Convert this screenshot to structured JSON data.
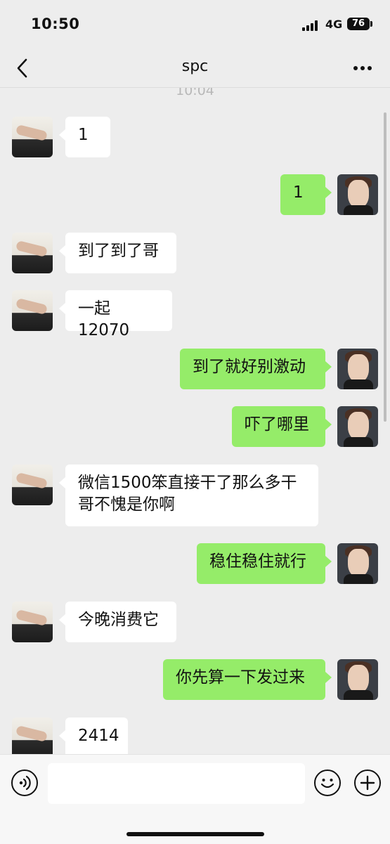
{
  "status_bar": {
    "time": "10:50",
    "network": "4G",
    "battery": "76"
  },
  "header": {
    "title": "spc"
  },
  "chat": {
    "timestamp": "10:04",
    "messages": [
      {
        "side": "left",
        "text": "1"
      },
      {
        "side": "right",
        "text": "1"
      },
      {
        "side": "left",
        "text": "到了到了哥"
      },
      {
        "side": "left",
        "text": "一起12070"
      },
      {
        "side": "right",
        "text": "到了就好别激动"
      },
      {
        "side": "right",
        "text": "吓了哪里"
      },
      {
        "side": "left",
        "text": "微信1500笨直接干了那么多干哥不愧是你啊"
      },
      {
        "side": "right",
        "text": "稳住稳住就行"
      },
      {
        "side": "left",
        "text": "今晚消费它"
      },
      {
        "side": "right",
        "text": "你先算一下发过来"
      },
      {
        "side": "left",
        "text": "2414"
      }
    ]
  },
  "input": {
    "placeholder": ""
  },
  "icons": {
    "back": "chevron-left-icon",
    "more": "more-dots-icon",
    "voice": "voice-icon",
    "emoji": "emoji-icon",
    "add": "plus-icon"
  },
  "colors": {
    "sent_bubble": "#95ec69",
    "received_bubble": "#ffffff",
    "background": "#ededed"
  }
}
